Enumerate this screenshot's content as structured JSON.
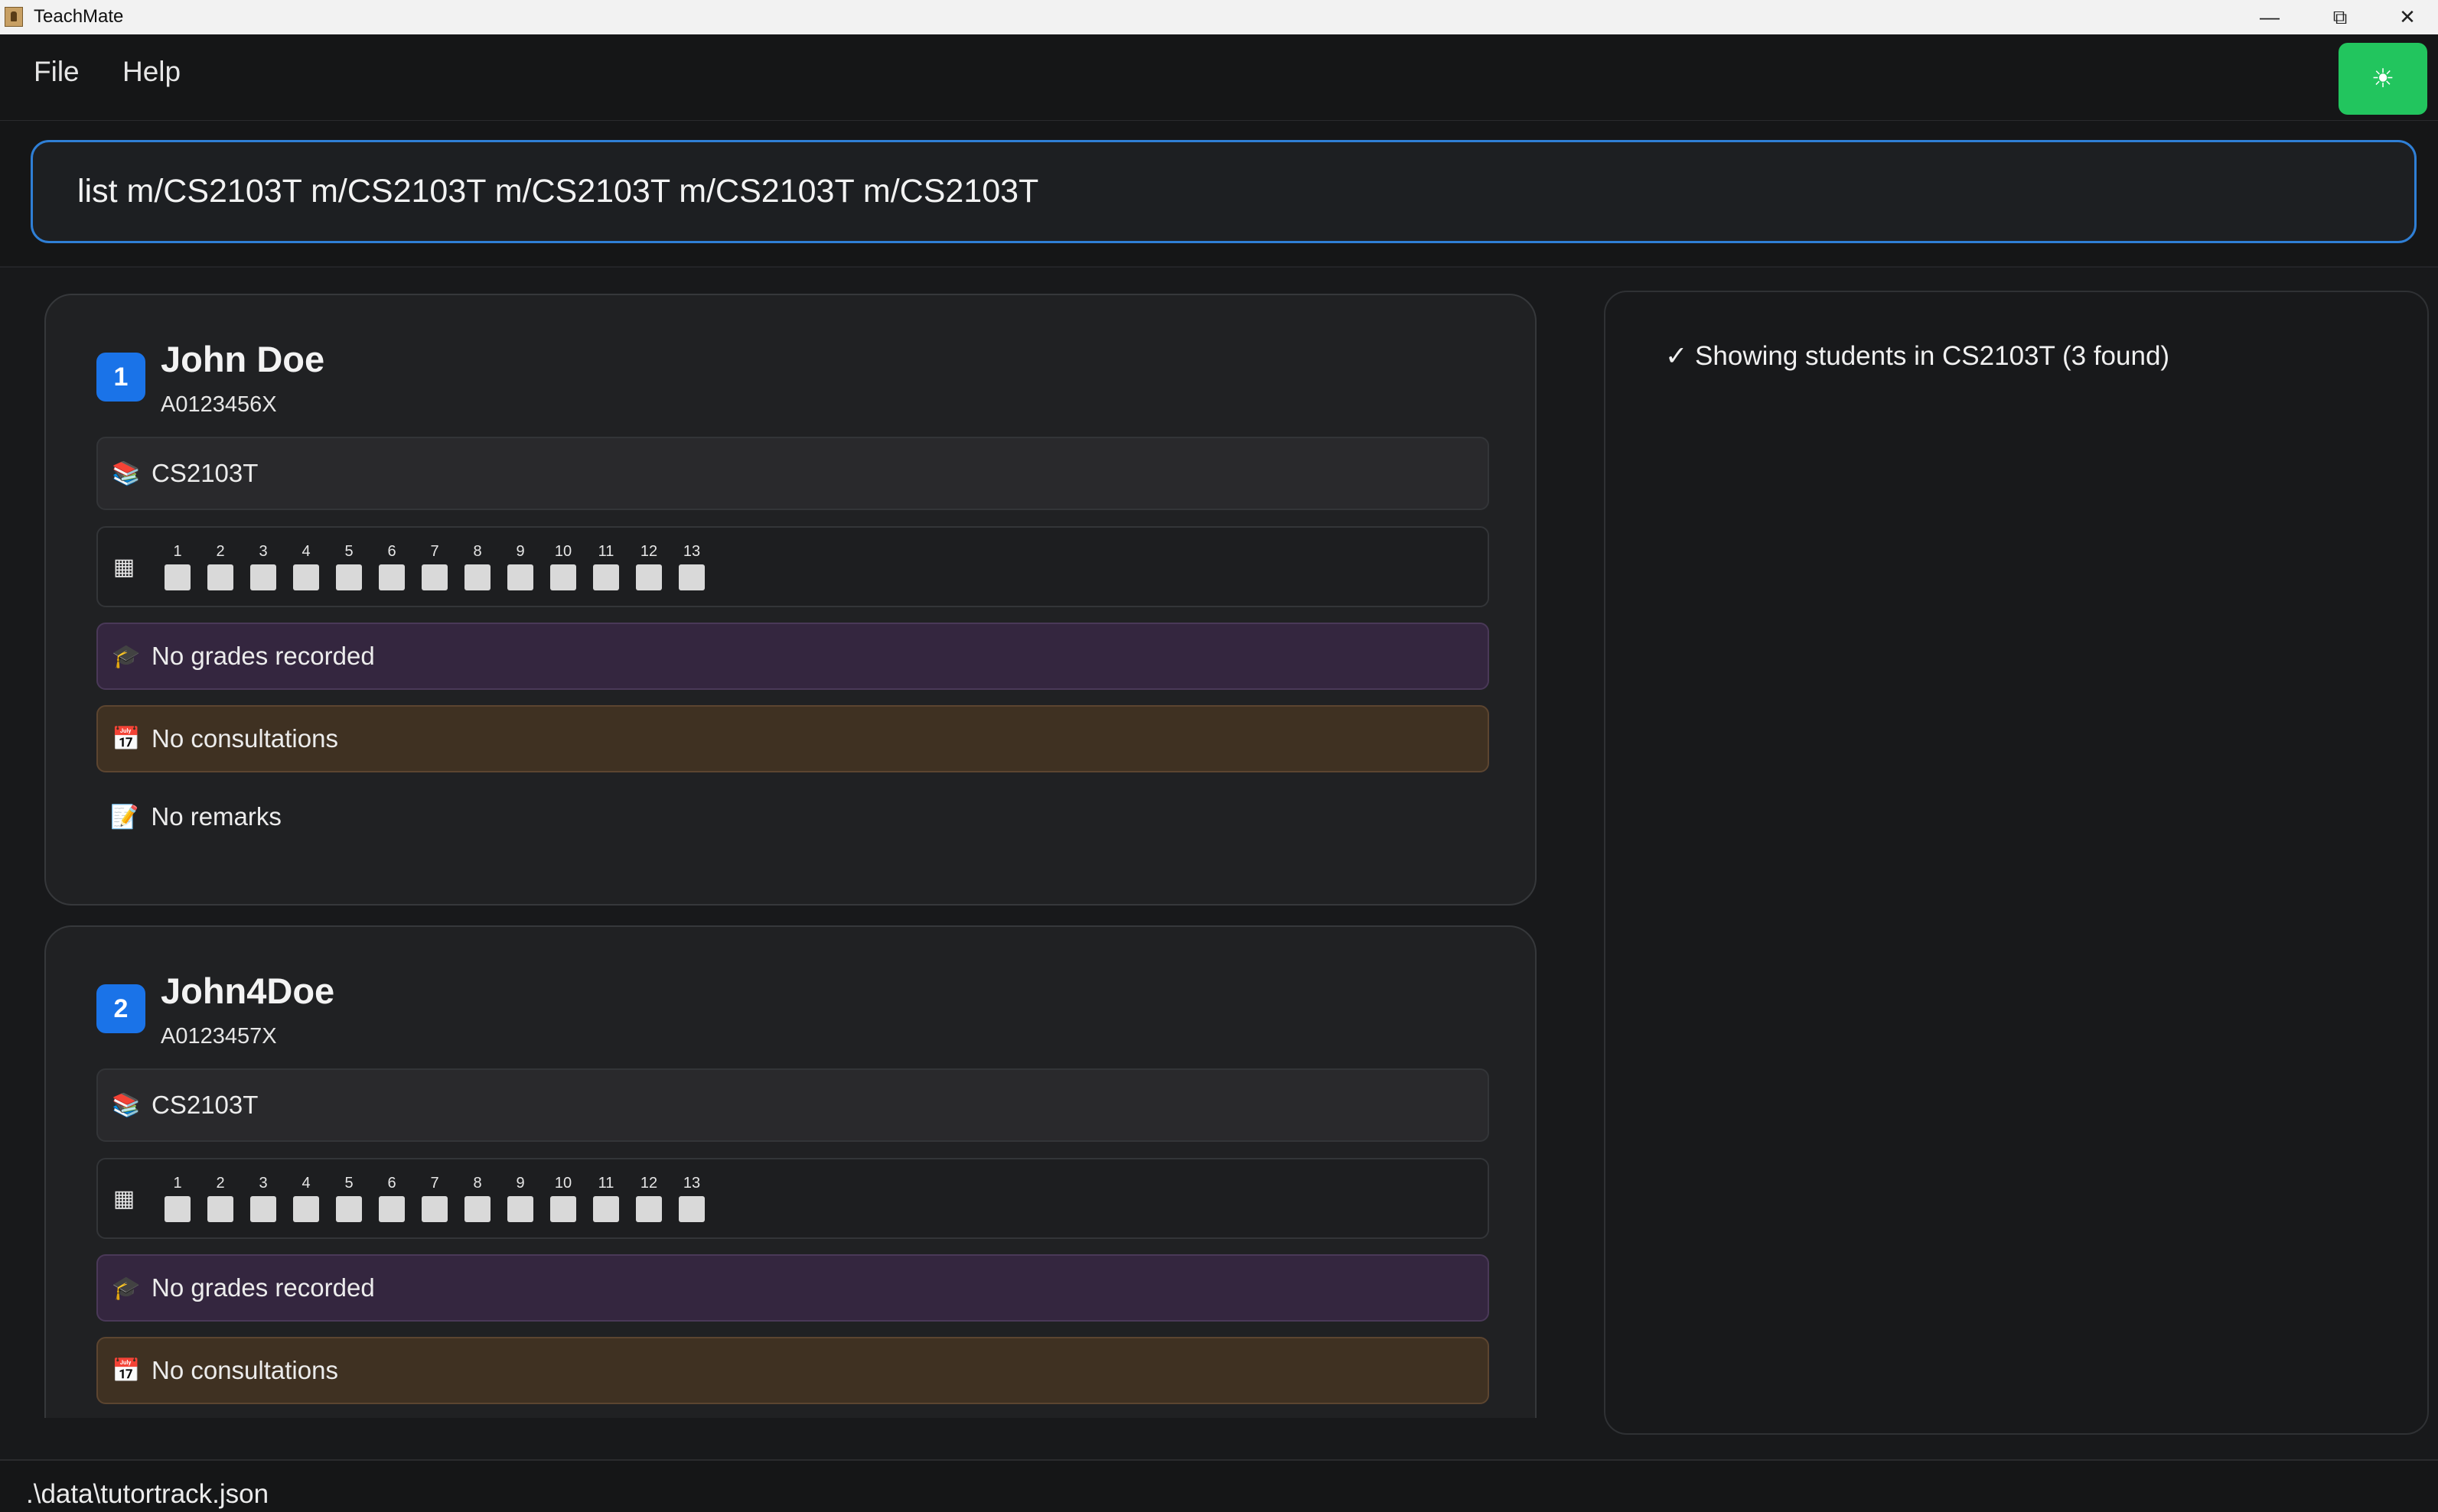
{
  "window": {
    "title": "TeachMate"
  },
  "menu": {
    "file": "File",
    "help": "Help",
    "theme_icon": "sun-icon"
  },
  "command": {
    "value": "list m/CS2103T m/CS2103T m/CS2103T m/CS2103T m/CS2103T"
  },
  "students": [
    {
      "index": "1",
      "name": "John Doe",
      "student_id": "A0123456X",
      "module": "CS2103T",
      "weeks": [
        "1",
        "2",
        "3",
        "4",
        "5",
        "6",
        "7",
        "8",
        "9",
        "10",
        "11",
        "12",
        "13"
      ],
      "grades": "No grades recorded",
      "consultations": "No consultations",
      "remarks": "No remarks"
    },
    {
      "index": "2",
      "name": "John4Doe",
      "student_id": "A0123457X",
      "module": "CS2103T",
      "weeks": [
        "1",
        "2",
        "3",
        "4",
        "5",
        "6",
        "7",
        "8",
        "9",
        "10",
        "11",
        "12",
        "13"
      ],
      "grades": "No grades recorded",
      "consultations": "No consultations"
    }
  ],
  "result": {
    "message": "✓ Showing students in CS2103T (3 found)"
  },
  "status": {
    "file_path": ".\\data\\tutortrack.json"
  }
}
